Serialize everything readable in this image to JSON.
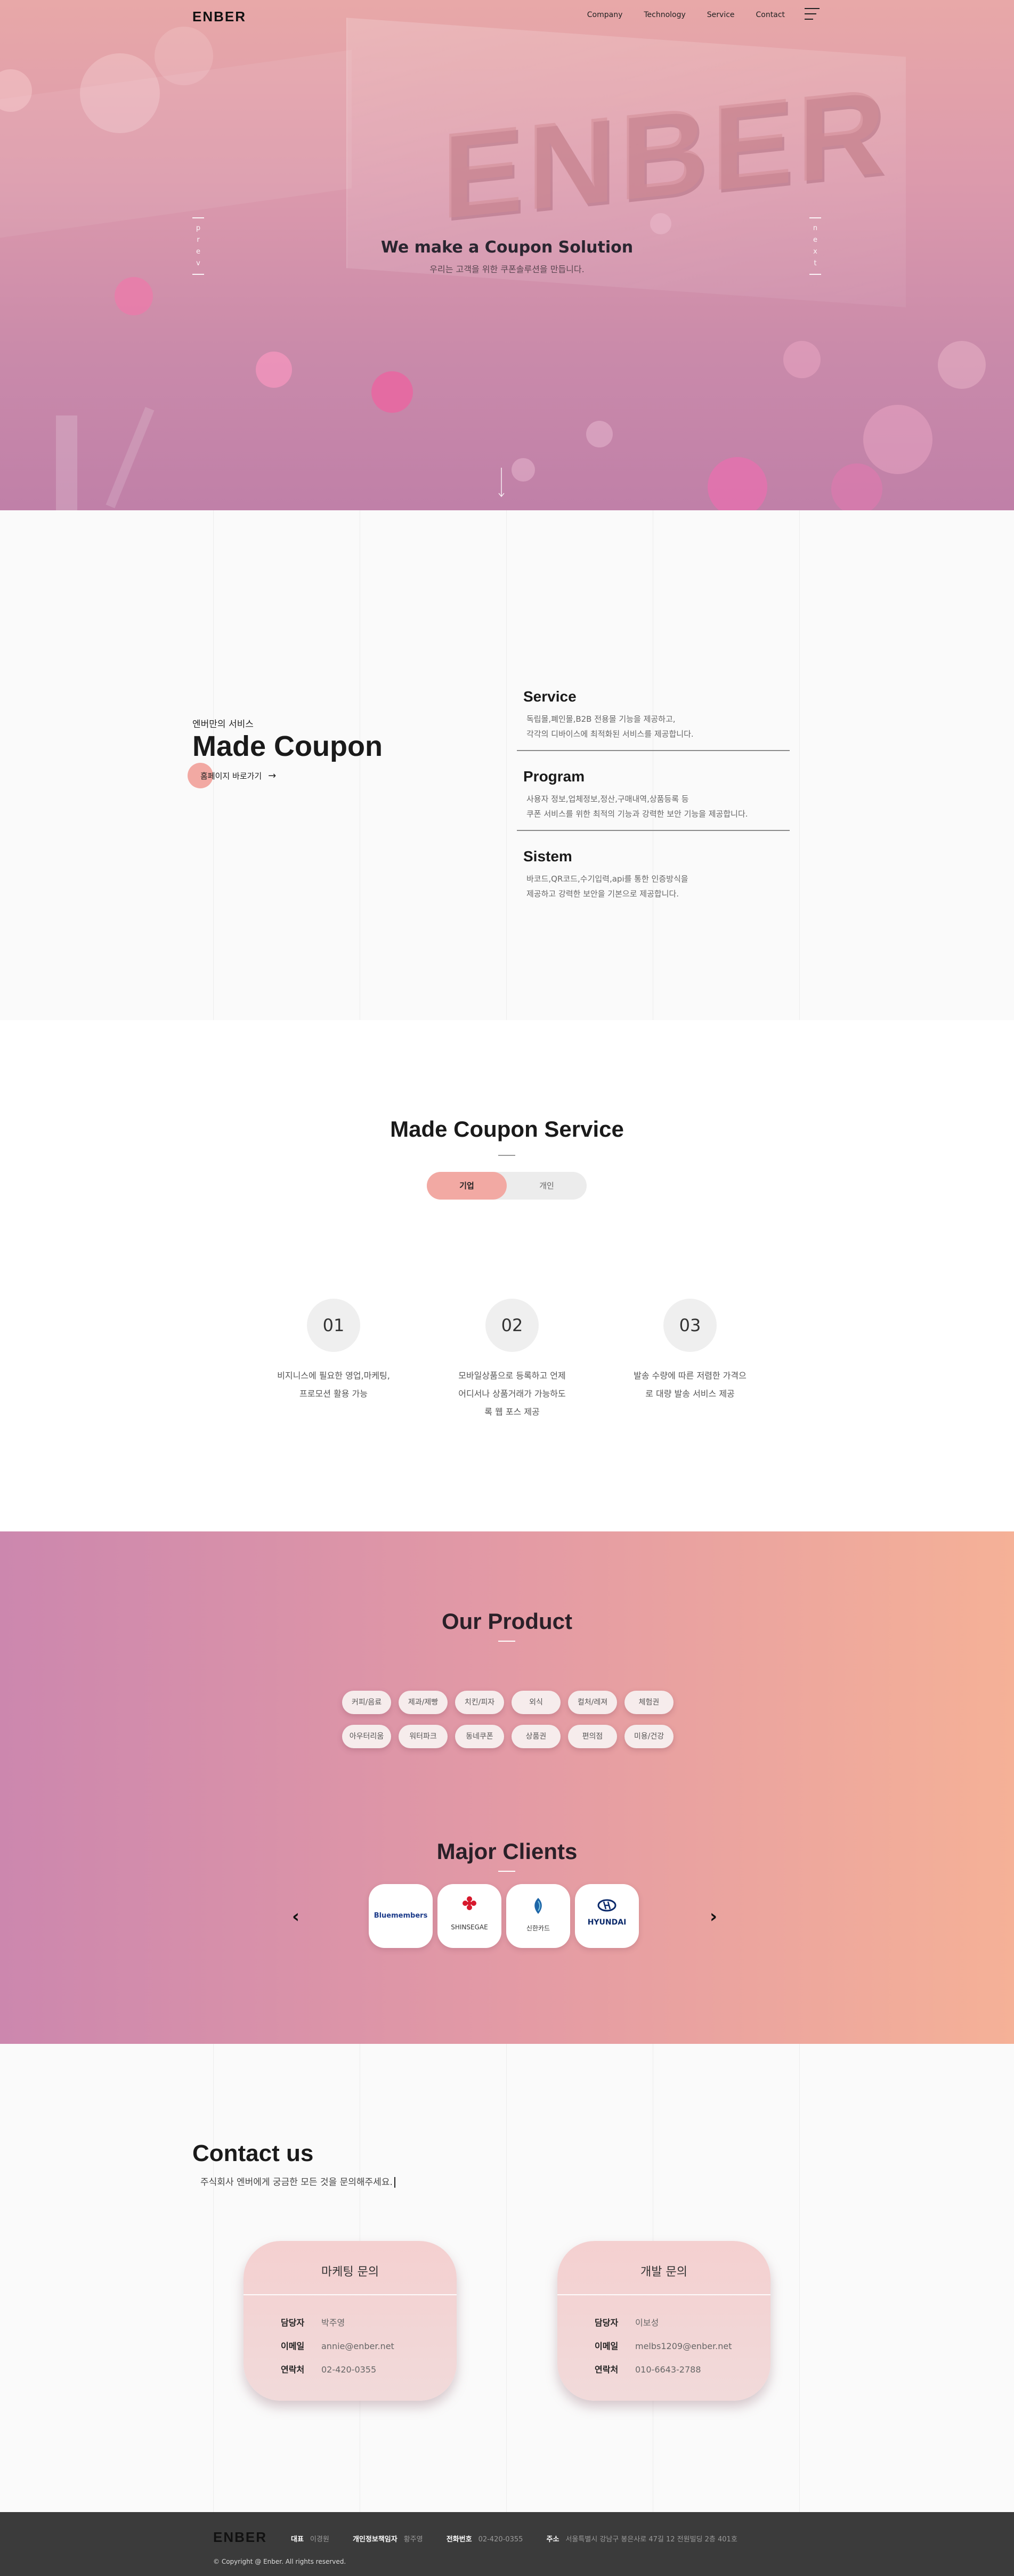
{
  "header": {
    "logo": "ENBER",
    "nav": [
      "Company",
      "Technology",
      "Service",
      "Contact"
    ]
  },
  "hero": {
    "background_word": "ENBER",
    "title": "We make a Coupon Solution",
    "subtitle": "우리는 고객을 위한 쿠폰솔루션을 만듭니다.",
    "prev_letters": [
      "p",
      "r",
      "e",
      "v"
    ],
    "next_letters": [
      "n",
      "e",
      "x",
      "t"
    ]
  },
  "made_coupon": {
    "label": "엔버만의 서비스",
    "title": "Made Coupon",
    "link": "홈페이지 바로가기",
    "features": [
      {
        "title": "Service",
        "lines": [
          "독립몰,폐인몰,B2B 전용몰 기능을 제공하고,",
          "각각의 디바이스에 최적화된 서비스를 제공합니다."
        ]
      },
      {
        "title": "Program",
        "lines": [
          "사용자 정보,업체정보,정산,구매내역,상품등록 등",
          "쿠폰 서비스를 위한 최적의 기능과 강력한 보안 기능을 제공합니다."
        ]
      },
      {
        "title": "Sistem",
        "lines": [
          "바코드,QR코드,수기입력,api를 통한 인증방식을",
          "제공하고 강력한 보안을 기본으로 제공합니다."
        ]
      }
    ]
  },
  "service": {
    "title": "Made Coupon Service",
    "tabs": [
      "기업",
      "개인"
    ],
    "active_tab": "기업",
    "steps": [
      {
        "num": "01",
        "lines": [
          "비지니스에 필요한 영업,마케팅,",
          "프로모션 활용 가능"
        ]
      },
      {
        "num": "02",
        "lines": [
          "모바일상품으로 등록하고 언제",
          "어디서나 상품거래가 가능하도",
          "록 웹 포스 제공"
        ]
      },
      {
        "num": "03",
        "lines": [
          "발송 수량에 따른 저렴한 가격으",
          "로 대량 발송 서비스 제공"
        ]
      }
    ]
  },
  "product": {
    "title": "Our Product",
    "chips_row1": [
      "커피/음료",
      "제과/제빵",
      "치킨/피자",
      "외식",
      "컬처/레져",
      "체험권"
    ],
    "chips_row2": [
      "아우터리움",
      "워터파크",
      "동네쿠폰",
      "상품권",
      "편의점",
      "미용/건강"
    ]
  },
  "clients": {
    "title": "Major Clients",
    "items": [
      {
        "name": "Bluemembers",
        "icon": "bluemembers-logo"
      },
      {
        "name": "SHINSEGAE",
        "icon": "shinsegae-logo"
      },
      {
        "name": "신한카드",
        "icon": "shinhan-card-logo"
      },
      {
        "name": "HYUNDAI",
        "icon": "hyundai-logo"
      }
    ]
  },
  "contact": {
    "title": "Contact us",
    "subtitle": "주식회사 엔버에게 궁금한 모든 것을 문의해주세요.",
    "cards": [
      {
        "title": "마케팅 문의",
        "rows": [
          {
            "k": "담당자",
            "v": "박주영"
          },
          {
            "k": "이메일",
            "v": "annie@enber.net"
          },
          {
            "k": "연락처",
            "v": "02-420-0355"
          }
        ]
      },
      {
        "title": "개발 문의",
        "rows": [
          {
            "k": "담당자",
            "v": "이보성"
          },
          {
            "k": "이메일",
            "v": "melbs1209@enber.net"
          },
          {
            "k": "연락처",
            "v": "010-6643-2788"
          }
        ]
      }
    ]
  },
  "footer": {
    "logo": "ENBER",
    "info": [
      {
        "k": "대표",
        "v": "이경원"
      },
      {
        "k": "개인정보책임자",
        "v": "황주영"
      },
      {
        "k": "전화번호",
        "v": "02-420-0355"
      },
      {
        "k": "주소",
        "v": "서울특별시 강남구 봉은사로 47길 12 전원빌딩 2층 401호"
      }
    ],
    "copyright": "© Copyright @ Enber. All rights reserved."
  },
  "colors": {
    "accent": "#f2a9a3",
    "footer": "#3b3b3b",
    "gradient_left": "#cc87ae",
    "gradient_right": "#f5b197"
  }
}
